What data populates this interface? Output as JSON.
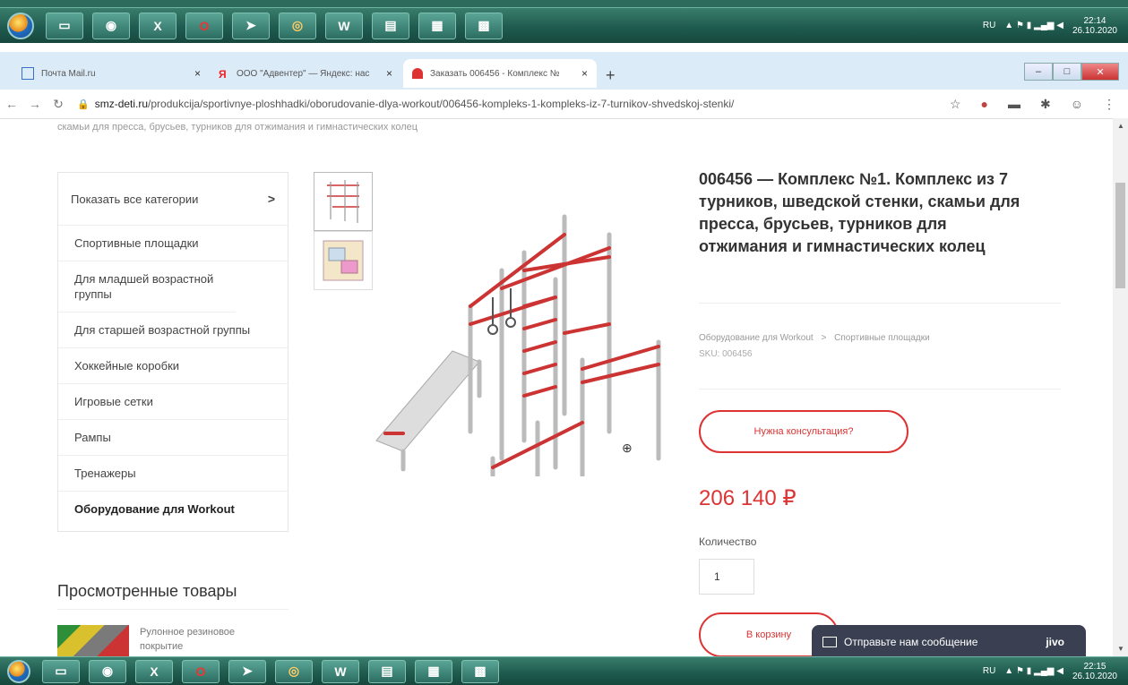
{
  "taskbar_top": {
    "lang": "RU",
    "time": "22:14",
    "date": "26.10.2020"
  },
  "taskbar_bottom": {
    "lang": "RU",
    "time": "22:15",
    "date": "26.10.2020"
  },
  "taskbar_icons": [
    "explorer-icon",
    "chrome-icon",
    "excel-icon",
    "opera-icon",
    "app-icon",
    "browser-icon",
    "word-icon",
    "notepad-icon",
    "winrar-icon",
    "app2-icon"
  ],
  "tabs": [
    {
      "title": "Почта Mail.ru",
      "close": "×"
    },
    {
      "title": "ООО \"Адвентер\" — Яндекс: нас",
      "close": "×"
    },
    {
      "title": "Заказать 006456 - Комплекс №",
      "close": "×"
    }
  ],
  "new_tab": "+",
  "address": {
    "host": "smz-deti.ru",
    "path": "/produkcija/sportivnye-ploshhadki/oborudovanie-dlya-workout/006456-kompleks-1-kompleks-iz-7-turnikov-shvedskoj-stenki/"
  },
  "cut_text": "скамьи для пресса, брусьев, турников для отжимания и гимнастических колец",
  "sidebar": {
    "show_all": "Показать все категории",
    "chevron": ">",
    "items": [
      "Спортивные площадки",
      "Для младшей возрастной группы",
      "Для старшей возрастной группы",
      "Хоккейные коробки",
      "Игровые сетки",
      "Рампы",
      "Тренажеры",
      "Оборудование для Workout"
    ]
  },
  "viewed": {
    "title": "Просмотренные товары",
    "item": "Рулонное резиновое покрытие"
  },
  "product": {
    "title": "006456 — Комплекс №1. Комплекс из 7 турников, шведской стенки, скамьи для пресса, брусьев, турников для отжимания и гимнастических колец",
    "crumb1": "Оборудование для Workout",
    "crumb_sep": ">",
    "crumb2": "Спортивные площадки",
    "sku": "SKU: 006456",
    "consult": "Нужна консультация?",
    "price": "206 140 ₽",
    "qty_label": "Количество",
    "qty": "1",
    "cart": "В корзину"
  },
  "jivo": {
    "text": "Отправьте нам сообщение",
    "brand": "jivo"
  }
}
